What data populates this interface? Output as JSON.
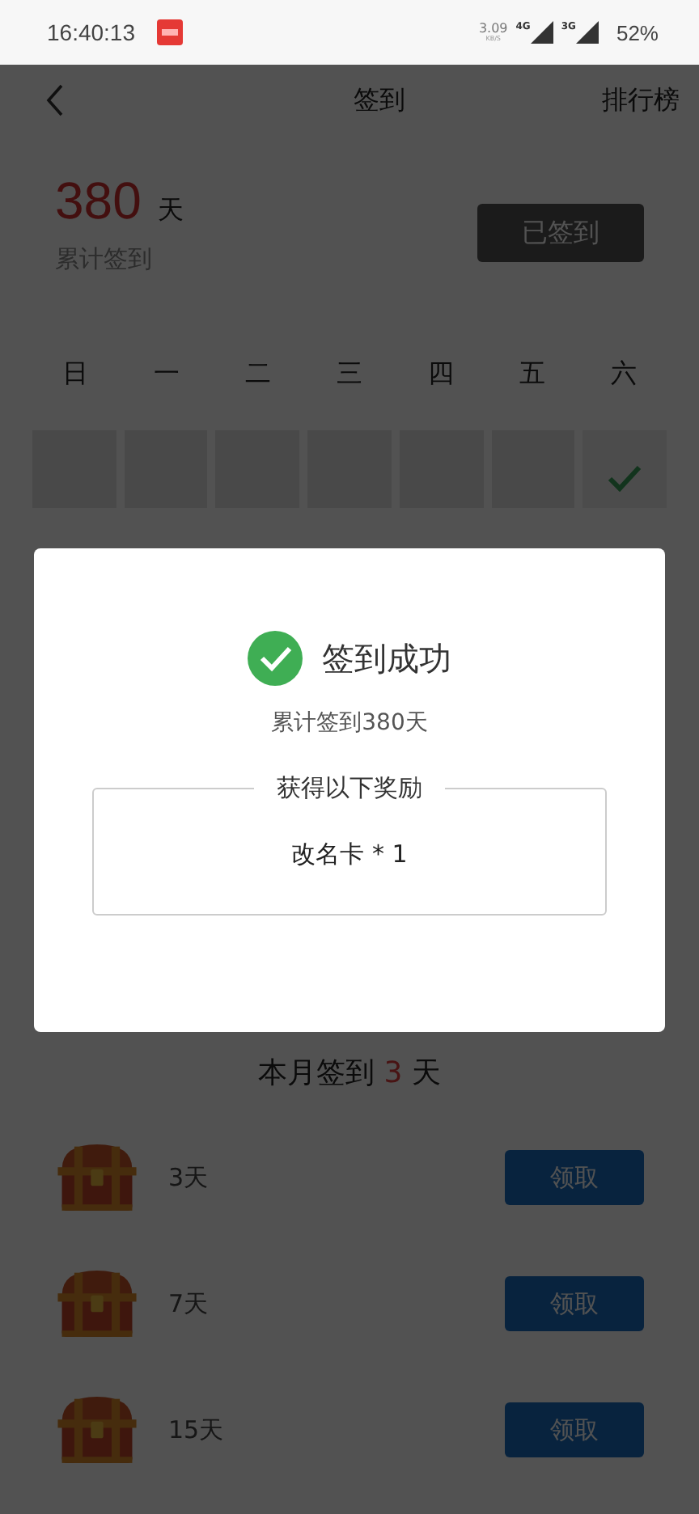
{
  "status_bar": {
    "time": "16:40:13",
    "net_speed": "3.09",
    "net_unit": "KB/S",
    "signals": [
      "4G",
      "3G"
    ],
    "battery": "52%"
  },
  "header": {
    "title": "签到",
    "action": "排行榜"
  },
  "summary": {
    "count": "380",
    "unit": "天",
    "label": "累计签到",
    "button": {
      "label": "已签到",
      "disabled": true
    }
  },
  "calendar": {
    "weekdays": [
      "日",
      "一",
      "二",
      "三",
      "四",
      "五",
      "六"
    ],
    "days": [
      {
        "signed": false
      },
      {
        "signed": false
      },
      {
        "signed": false
      },
      {
        "signed": false
      },
      {
        "signed": false
      },
      {
        "signed": false
      },
      {
        "signed": true
      }
    ]
  },
  "month": {
    "prefix": "本月签到",
    "count": "3",
    "suffix": "天"
  },
  "rewards": [
    {
      "days": "3天",
      "button": "领取"
    },
    {
      "days": "7天",
      "button": "领取"
    },
    {
      "days": "15天",
      "button": "领取"
    }
  ],
  "dialog": {
    "title": "签到成功",
    "subtitle": "累计签到380天",
    "reward_heading": "获得以下奖励",
    "reward_items": [
      "改名卡 * 1"
    ]
  }
}
